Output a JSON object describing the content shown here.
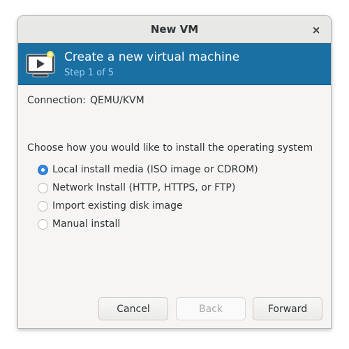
{
  "window": {
    "title": "New VM",
    "close_glyph": "×"
  },
  "banner": {
    "icon": "vm-screen-icon",
    "title": "Create a new virtual machine",
    "step": "Step 1 of 5",
    "background_color": "#1a6fa3"
  },
  "connection": {
    "label": "Connection:",
    "value": "QEMU/KVM"
  },
  "install": {
    "prompt": "Choose how you would like to install the operating system",
    "options": [
      {
        "label": "Local install media (ISO image or CDROM)",
        "checked": true
      },
      {
        "label": "Network Install (HTTP, HTTPS, or FTP)",
        "checked": false
      },
      {
        "label": "Import existing disk image",
        "checked": false
      },
      {
        "label": "Manual install",
        "checked": false
      }
    ]
  },
  "buttons": {
    "cancel": "Cancel",
    "back": "Back",
    "forward": "Forward"
  }
}
